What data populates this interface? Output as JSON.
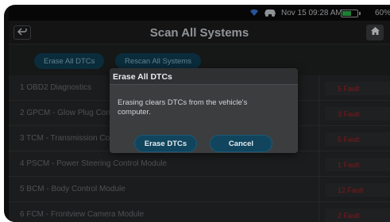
{
  "status_bar": {
    "wifi_icon": "wifi-icon",
    "car_icon": "car-icon",
    "time": "Nov 15  09:28 AM",
    "battery_level": 0.6,
    "battery_percent": "60%"
  },
  "header": {
    "back_icon": "back-arrow-icon",
    "title": "Scan All Systems",
    "home_icon": "home-icon"
  },
  "actions": {
    "erase_all_label": "Erase All DTCs",
    "rescan_label": "Rescan All Systems"
  },
  "modules": [
    {
      "name": "1  OBD2 Diagnostics",
      "fault": "5 Fault"
    },
    {
      "name": "2  GPCM - Glow Plug Control Module",
      "fault": "3 Fault"
    },
    {
      "name": "3  TCM - Transmission Control Module",
      "fault": "5 Fault"
    },
    {
      "name": "4  PSCM - Power Steering Control Module",
      "fault": "1 Fault"
    },
    {
      "name": "5  BCM - Body Control Module",
      "fault": "12 Fault"
    },
    {
      "name": "6  FCM - Frontview Camera Module",
      "fault": "2 Fault"
    }
  ],
  "dialog": {
    "title": "Erase All DTCs",
    "message": "Erasing clears DTCs from the vehicle's computer.",
    "confirm_label": "Erase DTCs",
    "cancel_label": "Cancel"
  },
  "colors": {
    "accent": "#11455d",
    "fault": "#a3252b",
    "background": "#222324"
  }
}
